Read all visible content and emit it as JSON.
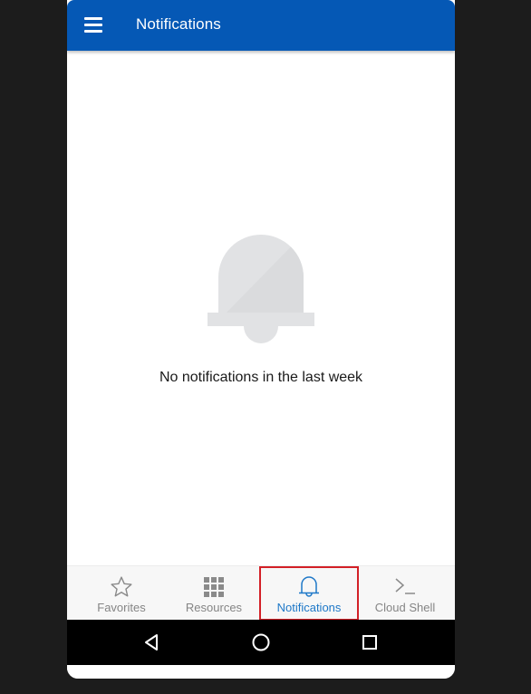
{
  "app_bar": {
    "title": "Notifications"
  },
  "empty_state": {
    "message": "No notifications in the last week"
  },
  "tabs": [
    {
      "label": "Favorites",
      "icon": "star-icon",
      "active": false
    },
    {
      "label": "Resources",
      "icon": "grid-icon",
      "active": false
    },
    {
      "label": "Notifications",
      "icon": "bell-icon",
      "active": true
    },
    {
      "label": "Cloud Shell",
      "icon": "terminal-icon",
      "active": false
    }
  ],
  "colors": {
    "app_bar": "#0558b5",
    "active_tab": "#1e78c8",
    "inactive_tab": "#858585",
    "highlight_box": "#d32027"
  }
}
